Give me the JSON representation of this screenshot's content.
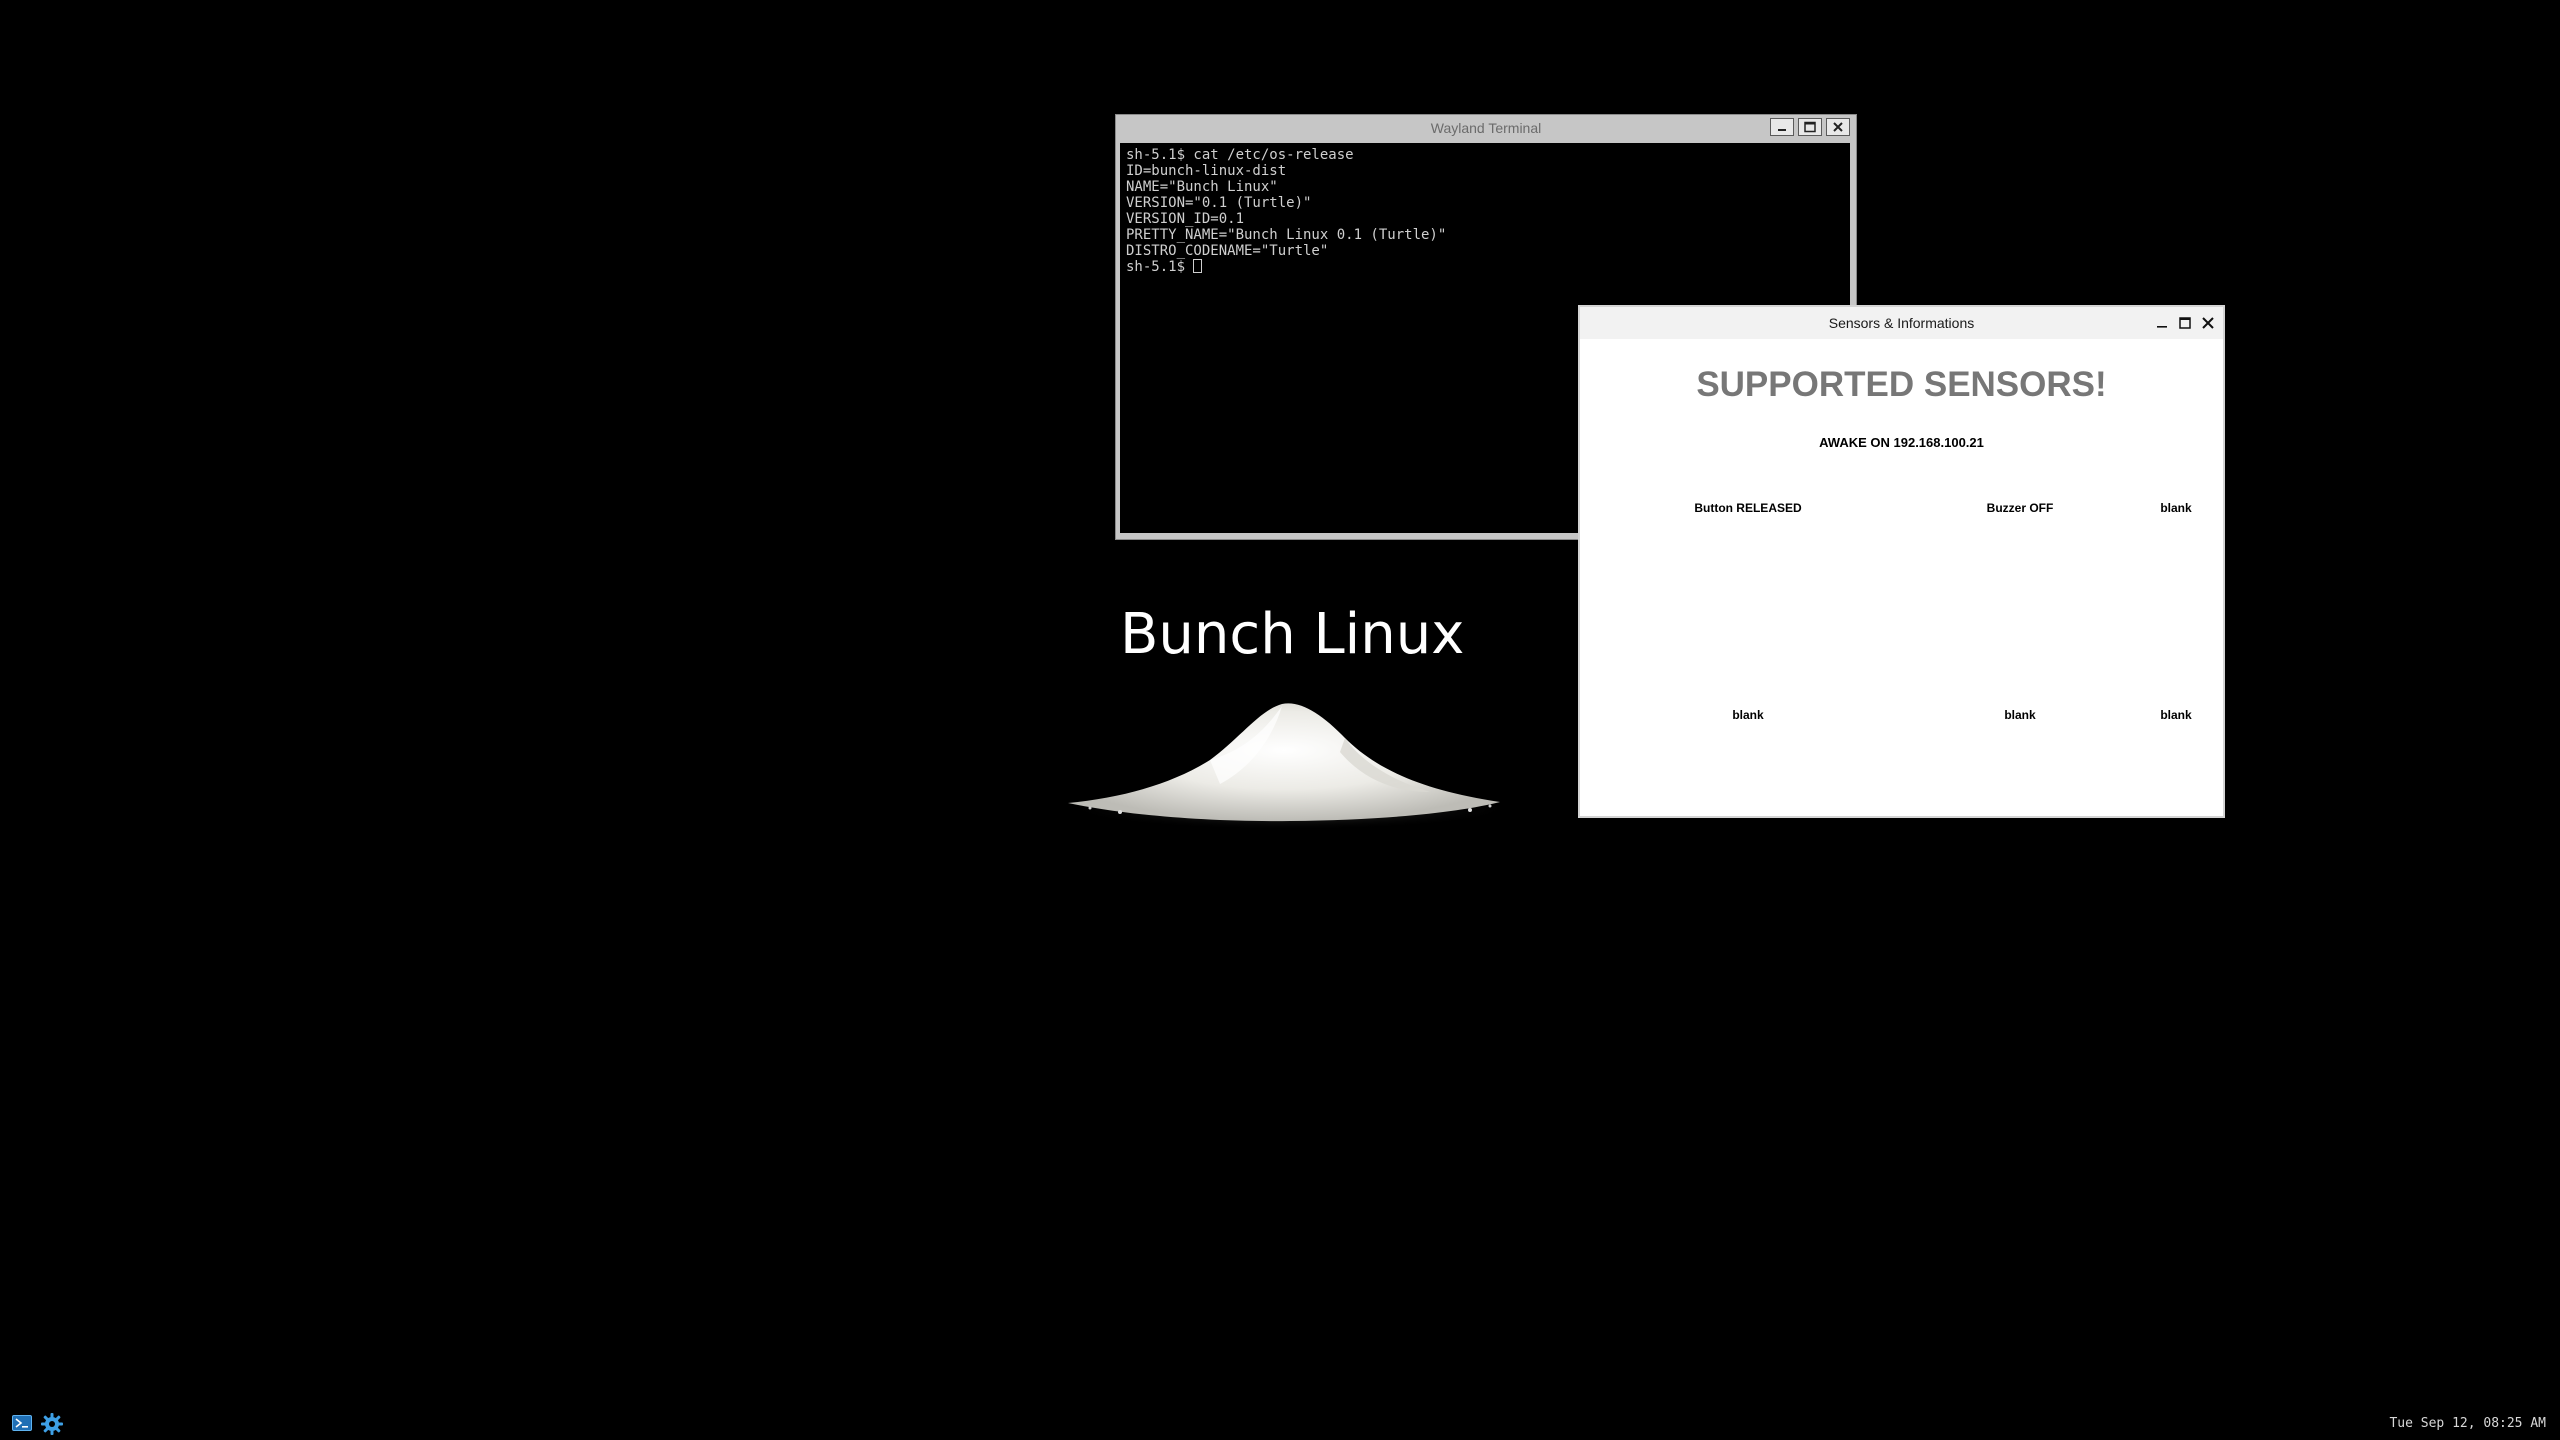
{
  "desktop": {
    "brand_title": "Bunch Linux"
  },
  "terminal": {
    "title": "Wayland Terminal",
    "lines": [
      "sh-5.1$ cat /etc/os-release",
      "ID=bunch-linux-dist",
      "NAME=\"Bunch Linux\"",
      "VERSION=\"0.1 (Turtle)\"",
      "VERSION_ID=0.1",
      "PRETTY_NAME=\"Bunch Linux 0.1 (Turtle)\"",
      "DISTRO_CODENAME=\"Turtle\""
    ],
    "prompt": "sh-5.1$ "
  },
  "sensors_window": {
    "title": "Sensors & Informations",
    "heading": "SUPPORTED SENSORS!",
    "status": "AWAKE ON 192.168.100.21",
    "cells": [
      "Button RELEASED",
      "Buzzer OFF",
      "blank",
      "blank",
      "blank",
      "blank"
    ]
  },
  "taskbar": {
    "clock": "Tue Sep 12, 08:25 AM",
    "launchers": [
      "terminal-icon",
      "settings-gear-icon"
    ]
  },
  "colors": {
    "desktop_bg": "#000000",
    "terminal_frame": "#c6c6c6",
    "heading_gray": "#777777",
    "taskbar_icon_blue": "#3ea0e6"
  }
}
